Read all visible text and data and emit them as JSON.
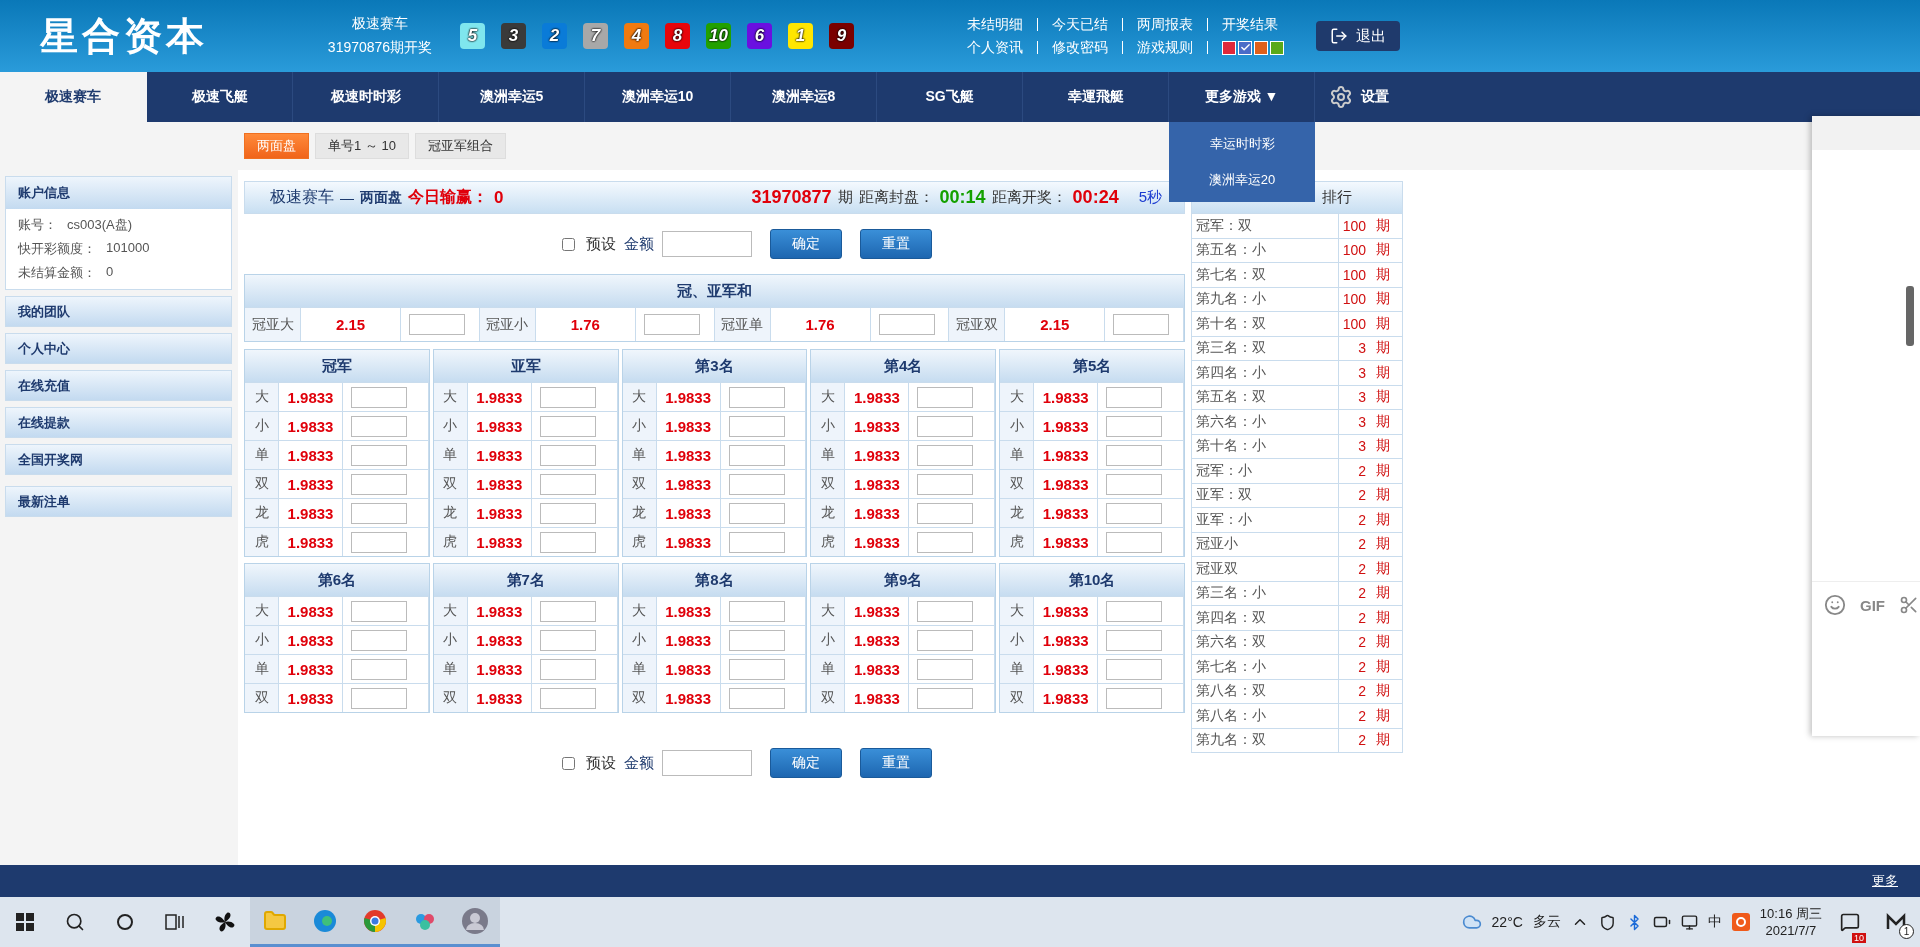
{
  "header": {
    "logo": "星合资本",
    "draw": {
      "game": "极速赛车",
      "period": "31970876期开奖",
      "balls": [
        {
          "number": "5",
          "color": "#7fe6ee"
        },
        {
          "number": "3",
          "color": "#3a3a3a"
        },
        {
          "number": "2",
          "color": "#0a7bd8"
        },
        {
          "number": "7",
          "color": "#a8a8a8"
        },
        {
          "number": "4",
          "color": "#f07a10"
        },
        {
          "number": "8",
          "color": "#e8050a"
        },
        {
          "number": "10",
          "color": "#22a000"
        },
        {
          "number": "6",
          "color": "#6a10e0"
        },
        {
          "number": "1",
          "color": "#ffe600"
        },
        {
          "number": "9",
          "color": "#7a0000"
        }
      ]
    },
    "links": [
      [
        "未结明细",
        "今天已结",
        "两周报表",
        "开奖结果"
      ],
      [
        "个人资讯",
        "修改密码",
        "游戏规则"
      ]
    ],
    "swatches": [
      {
        "color": "#e0283a",
        "selected": false
      },
      {
        "color": "#4a6cc8",
        "selected": true
      },
      {
        "color": "#e0601a",
        "selected": false
      },
      {
        "color": "#5aa91a",
        "selected": false
      }
    ],
    "logout": "退出"
  },
  "nav": {
    "items": [
      {
        "label": "极速赛车",
        "selected": true
      },
      {
        "label": "极速飞艇",
        "selected": false
      },
      {
        "label": "极速时时彩",
        "selected": false
      },
      {
        "label": "澳洲幸运5",
        "selected": false
      },
      {
        "label": "澳洲幸运10",
        "selected": false
      },
      {
        "label": "澳洲幸运8",
        "selected": false
      },
      {
        "label": "SG飞艇",
        "selected": false
      },
      {
        "label": "幸運飛艇",
        "selected": false
      }
    ],
    "more": {
      "label": "更多游戏",
      "arrow": "▼",
      "expanded": true,
      "menu": [
        "幸运时时彩",
        "澳洲幸运20"
      ]
    },
    "settings": "设置"
  },
  "subtabs": [
    {
      "label": "两面盘",
      "selected": true
    },
    {
      "label": "单号1 ～ 10",
      "selected": false
    },
    {
      "label": "冠亚军组合",
      "selected": false
    }
  ],
  "sidebar": {
    "account": {
      "title": "账户信息",
      "rows": [
        {
          "label": "账号：",
          "value": "cs003(A盘)"
        },
        {
          "label": "快开彩额度：",
          "value": "101000"
        },
        {
          "label": "未结算金额：",
          "value": "0"
        }
      ]
    },
    "menu": [
      "我的团队",
      "个人中心",
      "在线充值",
      "在线提款",
      "全国开奖网",
      "最新注单"
    ]
  },
  "main": {
    "title": {
      "game": "极速赛车",
      "dash": "—",
      "mode": "两面盘",
      "today_label": "今日输赢：",
      "today_value": "0",
      "period": "31970877",
      "period_unit": "期",
      "close_label": "距离封盘：",
      "close_time": "00:14",
      "draw_label": "距离开奖：",
      "draw_time": "00:24",
      "refresh": "5秒"
    },
    "forms": [
      {
        "preset_label": "预设",
        "preset_checked": false,
        "amount_label": "金额",
        "confirm": "确定",
        "reset": "重置"
      },
      {
        "preset_label": "预设",
        "preset_checked": false,
        "amount_label": "金额",
        "confirm": "确定",
        "reset": "重置"
      }
    ],
    "sum": {
      "title": "冠、亚军和",
      "items": [
        {
          "label": "冠亚大",
          "odds": "2.15"
        },
        {
          "label": "冠亚小",
          "odds": "1.76"
        },
        {
          "label": "冠亚单",
          "odds": "1.76"
        },
        {
          "label": "冠亚双",
          "odds": "2.15"
        }
      ]
    },
    "positions": [
      {
        "title": "冠军",
        "rows": [
          {
            "label": "大",
            "odds": "1.9833"
          },
          {
            "label": "小",
            "odds": "1.9833"
          },
          {
            "label": "单",
            "odds": "1.9833"
          },
          {
            "label": "双",
            "odds": "1.9833"
          },
          {
            "label": "龙",
            "odds": "1.9833"
          },
          {
            "label": "虎",
            "odds": "1.9833"
          }
        ]
      },
      {
        "title": "亚军",
        "rows": [
          {
            "label": "大",
            "odds": "1.9833"
          },
          {
            "label": "小",
            "odds": "1.9833"
          },
          {
            "label": "单",
            "odds": "1.9833"
          },
          {
            "label": "双",
            "odds": "1.9833"
          },
          {
            "label": "龙",
            "odds": "1.9833"
          },
          {
            "label": "虎",
            "odds": "1.9833"
          }
        ]
      },
      {
        "title": "第3名",
        "rows": [
          {
            "label": "大",
            "odds": "1.9833"
          },
          {
            "label": "小",
            "odds": "1.9833"
          },
          {
            "label": "单",
            "odds": "1.9833"
          },
          {
            "label": "双",
            "odds": "1.9833"
          },
          {
            "label": "龙",
            "odds": "1.9833"
          },
          {
            "label": "虎",
            "odds": "1.9833"
          }
        ]
      },
      {
        "title": "第4名",
        "rows": [
          {
            "label": "大",
            "odds": "1.9833"
          },
          {
            "label": "小",
            "odds": "1.9833"
          },
          {
            "label": "单",
            "odds": "1.9833"
          },
          {
            "label": "双",
            "odds": "1.9833"
          },
          {
            "label": "龙",
            "odds": "1.9833"
          },
          {
            "label": "虎",
            "odds": "1.9833"
          }
        ]
      },
      {
        "title": "第5名",
        "rows": [
          {
            "label": "大",
            "odds": "1.9833"
          },
          {
            "label": "小",
            "odds": "1.9833"
          },
          {
            "label": "单",
            "odds": "1.9833"
          },
          {
            "label": "双",
            "odds": "1.9833"
          },
          {
            "label": "龙",
            "odds": "1.9833"
          },
          {
            "label": "虎",
            "odds": "1.9833"
          }
        ]
      },
      {
        "title": "第6名",
        "rows": [
          {
            "label": "大",
            "odds": "1.9833"
          },
          {
            "label": "小",
            "odds": "1.9833"
          },
          {
            "label": "单",
            "odds": "1.9833"
          },
          {
            "label": "双",
            "odds": "1.9833"
          }
        ]
      },
      {
        "title": "第7名",
        "rows": [
          {
            "label": "大",
            "odds": "1.9833"
          },
          {
            "label": "小",
            "odds": "1.9833"
          },
          {
            "label": "单",
            "odds": "1.9833"
          },
          {
            "label": "双",
            "odds": "1.9833"
          }
        ]
      },
      {
        "title": "第8名",
        "rows": [
          {
            "label": "大",
            "odds": "1.9833"
          },
          {
            "label": "小",
            "odds": "1.9833"
          },
          {
            "label": "单",
            "odds": "1.9833"
          },
          {
            "label": "双",
            "odds": "1.9833"
          }
        ]
      },
      {
        "title": "第9名",
        "rows": [
          {
            "label": "大",
            "odds": "1.9833"
          },
          {
            "label": "小",
            "odds": "1.9833"
          },
          {
            "label": "单",
            "odds": "1.9833"
          },
          {
            "label": "双",
            "odds": "1.9833"
          }
        ]
      },
      {
        "title": "第10名",
        "rows": [
          {
            "label": "大",
            "odds": "1.9833"
          },
          {
            "label": "小",
            "odds": "1.9833"
          },
          {
            "label": "单",
            "odds": "1.9833"
          },
          {
            "label": "双",
            "odds": "1.9833"
          }
        ]
      }
    ]
  },
  "ranking": {
    "title": "排行",
    "rows": [
      {
        "label": "冠军：双",
        "count": "100",
        "unit": "期"
      },
      {
        "label": "第五名：小",
        "count": "100",
        "unit": "期"
      },
      {
        "label": "第七名：双",
        "count": "100",
        "unit": "期"
      },
      {
        "label": "第九名：小",
        "count": "100",
        "unit": "期"
      },
      {
        "label": "第十名：双",
        "count": "100",
        "unit": "期"
      },
      {
        "label": "第三名：双",
        "count": "3",
        "unit": "期"
      },
      {
        "label": "第四名：小",
        "count": "3",
        "unit": "期"
      },
      {
        "label": "第五名：双",
        "count": "3",
        "unit": "期"
      },
      {
        "label": "第六名：小",
        "count": "3",
        "unit": "期"
      },
      {
        "label": "第十名：小",
        "count": "3",
        "unit": "期"
      },
      {
        "label": "冠军：小",
        "count": "2",
        "unit": "期"
      },
      {
        "label": "亚军：双",
        "count": "2",
        "unit": "期"
      },
      {
        "label": "亚军：小",
        "count": "2",
        "unit": "期"
      },
      {
        "label": "冠亚小",
        "count": "2",
        "unit": "期"
      },
      {
        "label": "冠亚双",
        "count": "2",
        "unit": "期"
      },
      {
        "label": "第三名：小",
        "count": "2",
        "unit": "期"
      },
      {
        "label": "第四名：双",
        "count": "2",
        "unit": "期"
      },
      {
        "label": "第六名：双",
        "count": "2",
        "unit": "期"
      },
      {
        "label": "第七名：小",
        "count": "2",
        "unit": "期"
      },
      {
        "label": "第八名：双",
        "count": "2",
        "unit": "期"
      },
      {
        "label": "第八名：小",
        "count": "2",
        "unit": "期"
      },
      {
        "label": "第九名：双",
        "count": "2",
        "unit": "期"
      }
    ]
  },
  "chat": {
    "gif": "GIF"
  },
  "footer": {
    "more": "更多"
  },
  "taskbar": {
    "weather": "22°C",
    "condition": "多云",
    "ime": "中",
    "time": "10:16 周三",
    "date": "2021/7/7",
    "notifications": "10",
    "badge": "1"
  }
}
